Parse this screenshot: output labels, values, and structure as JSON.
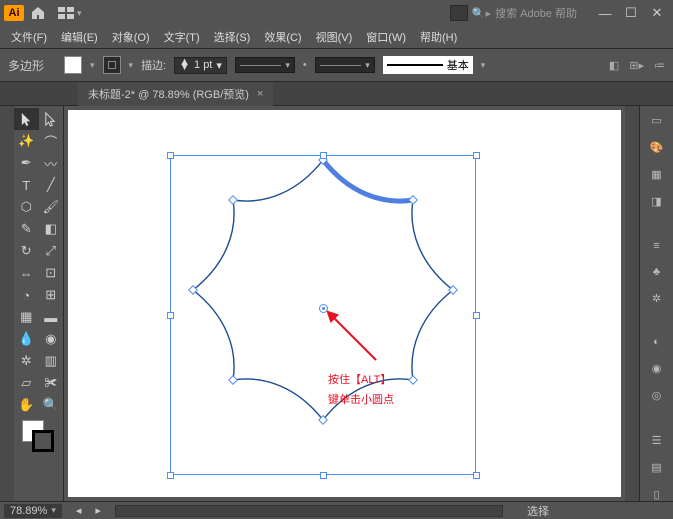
{
  "app": {
    "badge": "Ai",
    "search_placeholder": "搜索 Adobe 帮助"
  },
  "menus": [
    "文件(F)",
    "编辑(E)",
    "对象(O)",
    "文字(T)",
    "选择(S)",
    "效果(C)",
    "视图(V)",
    "窗口(W)",
    "帮助(H)"
  ],
  "control": {
    "shape_label": "多边形",
    "stroke_label": "描边:",
    "stroke_value": "1 pt",
    "style_label": "基本"
  },
  "document": {
    "tab_title": "未标题-2* @ 78.89% (RGB/预览)"
  },
  "annotation": {
    "line1": "按住【ALT】",
    "line2": "键单击小圆点"
  },
  "status": {
    "zoom": "78.89%",
    "mode": "选择"
  },
  "colors": {
    "accent": "#4f8ff0",
    "annotation": "#e81123"
  }
}
